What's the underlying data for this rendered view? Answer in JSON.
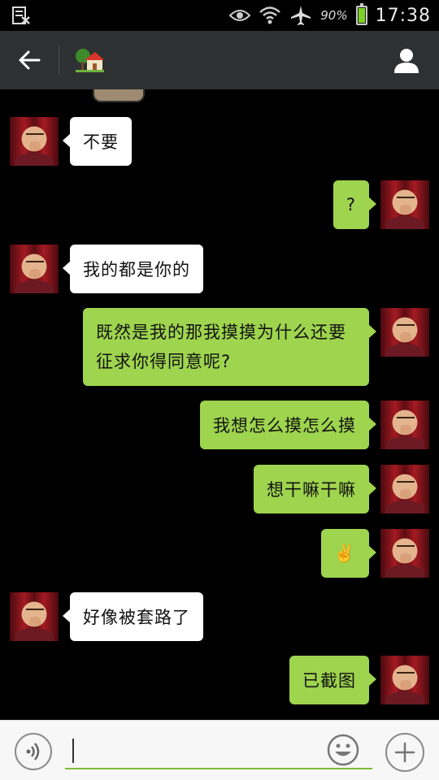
{
  "status_bar": {
    "battery_percent": "90%",
    "battery_level": 0.9,
    "time": "17:38",
    "icons": [
      "screenshot-icon",
      "eye-icon",
      "wifi-icon",
      "airplane-icon",
      "battery-icon"
    ]
  },
  "title_bar": {
    "back_icon": "back-arrow-icon",
    "title_emoji": "🏡",
    "profile_icon": "person-icon"
  },
  "messages": [
    {
      "from": "other",
      "text": "不要"
    },
    {
      "from": "me",
      "text": "?"
    },
    {
      "from": "other",
      "text": "我的都是你的"
    },
    {
      "from": "me",
      "text": "既然是我的那我摸摸为什么还要征求你得同意呢?"
    },
    {
      "from": "me",
      "text": "我想怎么摸怎么摸"
    },
    {
      "from": "me",
      "text": "想干嘛干嘛"
    },
    {
      "from": "me",
      "text": "✌️"
    },
    {
      "from": "other",
      "text": "好像被套路了"
    },
    {
      "from": "me",
      "text": "已截图"
    }
  ],
  "input_bar": {
    "voice_icon": "voice-icon",
    "input_value": "",
    "emoji_icon": "emoji-icon",
    "plus_icon": "plus-icon"
  },
  "colors": {
    "chat_background": "#000000",
    "title_bar": "#2e3132",
    "outgoing_bubble": "#9ed44e",
    "incoming_bubble": "#ffffff",
    "input_underline": "#7cbc3a"
  }
}
